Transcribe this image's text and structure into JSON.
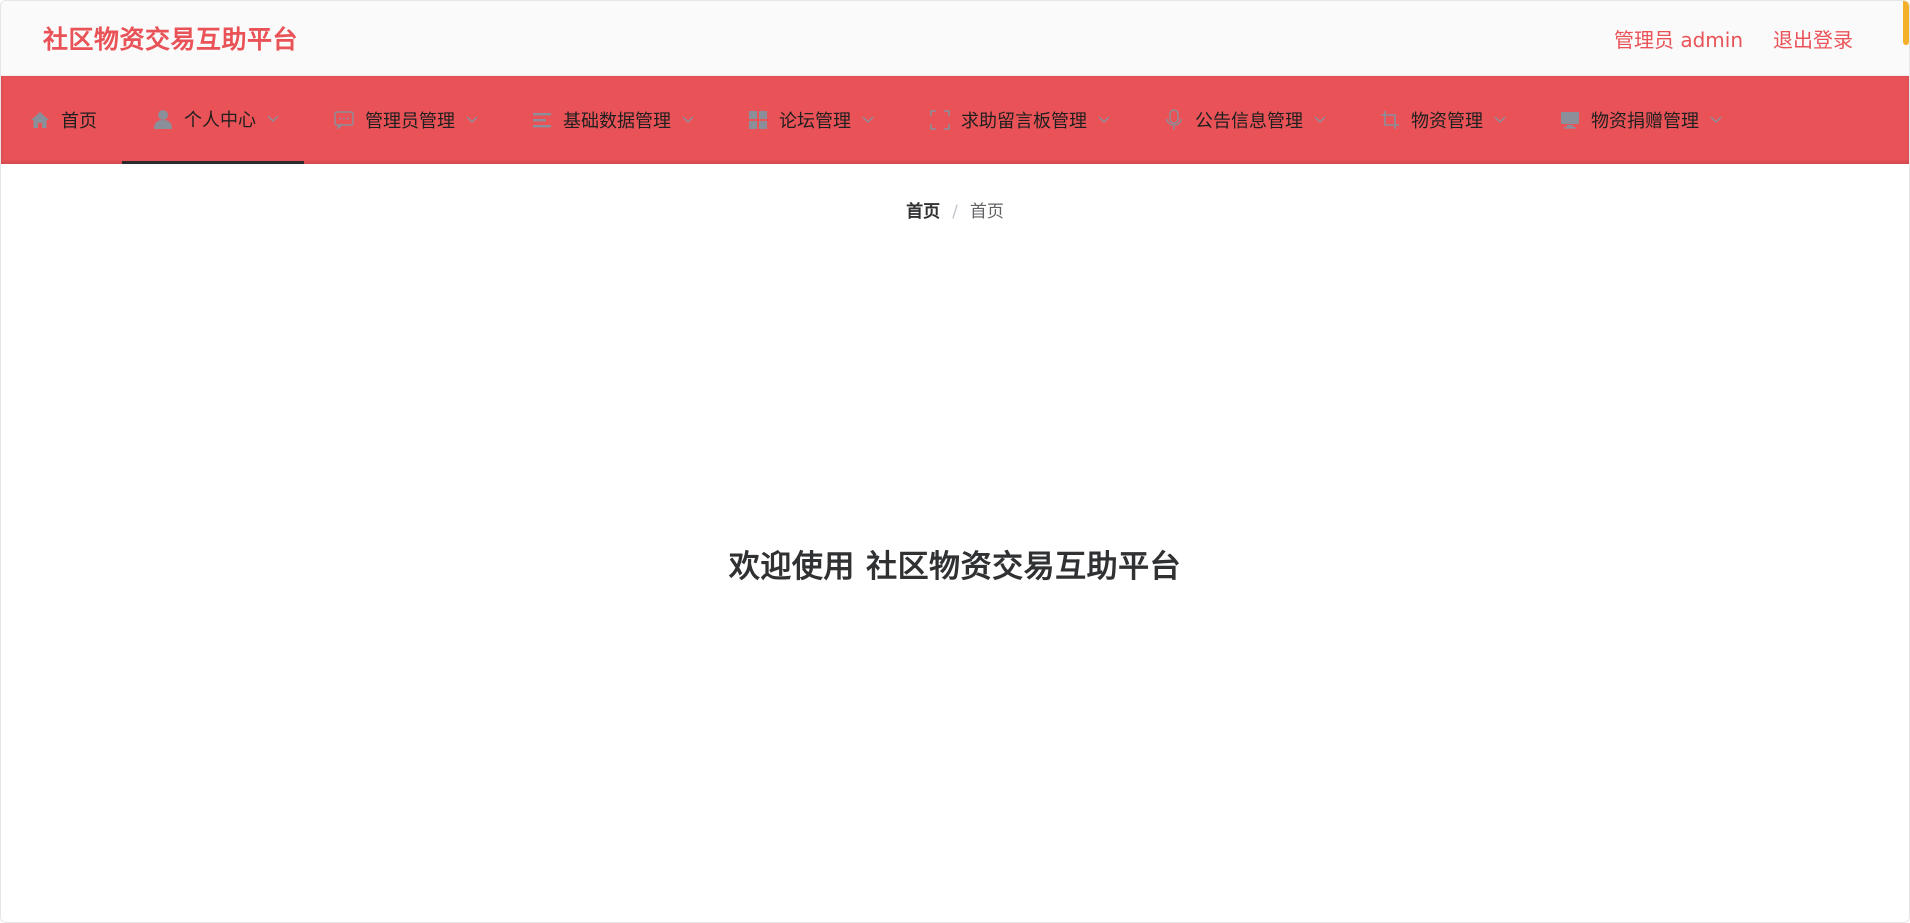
{
  "header": {
    "title": "社区物资交易互助平台",
    "user_label": "管理员 admin",
    "logout_label": "退出登录"
  },
  "colors": {
    "primary": "#e95358",
    "accent_scroll": "#f5b02b"
  },
  "nav": {
    "items": [
      {
        "label": "首页",
        "icon": "home-icon",
        "has_dropdown": false
      },
      {
        "label": "个人中心",
        "icon": "user-icon",
        "has_dropdown": true,
        "active": true
      },
      {
        "label": "管理员管理",
        "icon": "chat-dots-icon",
        "has_dropdown": true
      },
      {
        "label": "基础数据管理",
        "icon": "list-icon",
        "has_dropdown": true
      },
      {
        "label": "论坛管理",
        "icon": "grid-icon",
        "has_dropdown": true
      },
      {
        "label": "求助留言板管理",
        "icon": "fullscreen-icon",
        "has_dropdown": true
      },
      {
        "label": "公告信息管理",
        "icon": "microphone-icon",
        "has_dropdown": true
      },
      {
        "label": "物资管理",
        "icon": "crop-icon",
        "has_dropdown": true
      },
      {
        "label": "物资捐赠管理",
        "icon": "monitor-icon",
        "has_dropdown": true
      }
    ]
  },
  "breadcrumb": {
    "items": [
      "首页",
      "首页"
    ],
    "separator": "/"
  },
  "main": {
    "welcome": "欢迎使用 社区物资交易互助平台"
  }
}
